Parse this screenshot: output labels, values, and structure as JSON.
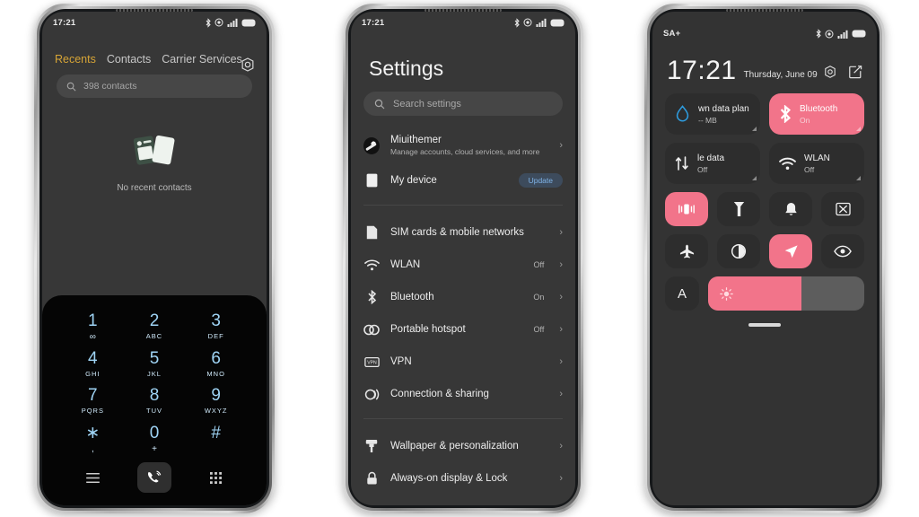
{
  "phone1": {
    "status": {
      "time": "17:21",
      "icons": [
        "bluetooth-icon",
        "location-icon",
        "signal-icon",
        "battery-icon"
      ]
    },
    "settings_icon": "gear-icon",
    "tabs": [
      {
        "label": "Recents",
        "active": true
      },
      {
        "label": "Contacts",
        "active": false
      },
      {
        "label": "Carrier Services",
        "active": false
      }
    ],
    "search": {
      "placeholder": "398 contacts",
      "icon": "search-icon"
    },
    "empty_state": {
      "label": "No recent contacts",
      "icon": "contacts-cards-icon"
    },
    "keypad": {
      "keys": [
        {
          "digit": "1",
          "sub": "∞",
          "tiny": true
        },
        {
          "digit": "2",
          "sub": "ABC"
        },
        {
          "digit": "3",
          "sub": "DEF"
        },
        {
          "digit": "4",
          "sub": "GHI"
        },
        {
          "digit": "5",
          "sub": "JKL"
        },
        {
          "digit": "6",
          "sub": "MNO"
        },
        {
          "digit": "7",
          "sub": "PQRS"
        },
        {
          "digit": "8",
          "sub": "TUV"
        },
        {
          "digit": "9",
          "sub": "WXYZ"
        },
        {
          "digit": "∗",
          "sub": ","
        },
        {
          "digit": "0",
          "sub": "+"
        },
        {
          "digit": "#",
          "sub": ""
        }
      ],
      "bottom": {
        "left_icon": "menu-icon",
        "call_icon": "call-icon",
        "right_icon": "dialpad-icon"
      }
    },
    "accent": "#d6a436"
  },
  "phone2": {
    "status": {
      "time": "17:21",
      "icons": [
        "bluetooth-icon",
        "location-icon",
        "signal-icon",
        "battery-icon"
      ]
    },
    "title": "Settings",
    "search": {
      "placeholder": "Search settings",
      "icon": "search-icon"
    },
    "account": {
      "name": "Miuithemer",
      "subtitle": "Manage accounts, cloud services, and more",
      "icon": "account-avatar"
    },
    "device": {
      "label": "My device",
      "badge": "Update",
      "icon": "device-icon"
    },
    "items": [
      {
        "label": "SIM cards & mobile networks",
        "value": "",
        "icon": "sim-icon"
      },
      {
        "label": "WLAN",
        "value": "Off",
        "icon": "wifi-icon"
      },
      {
        "label": "Bluetooth",
        "value": "On",
        "icon": "bluetooth-icon"
      },
      {
        "label": "Portable hotspot",
        "value": "Off",
        "icon": "hotspot-icon"
      },
      {
        "label": "VPN",
        "value": "",
        "icon": "vpn-icon"
      },
      {
        "label": "Connection & sharing",
        "value": "",
        "icon": "connection-sharing-icon"
      }
    ],
    "items2": [
      {
        "label": "Wallpaper & personalization",
        "value": "",
        "icon": "brush-icon"
      },
      {
        "label": "Always-on display & Lock",
        "value": "",
        "icon": "lock-icon"
      }
    ],
    "chevron": "›",
    "update_color": "#7fb4e8"
  },
  "phone3": {
    "status": {
      "left": "SA+",
      "icons": [
        "bluetooth-icon",
        "location-icon",
        "signal-icon",
        "battery-icon"
      ]
    },
    "clock": {
      "time": "17:21",
      "date": "Thursday, June 09"
    },
    "header_actions": [
      {
        "icon": "gear-icon",
        "name": "settings-shortcut"
      },
      {
        "icon": "edit-icon",
        "name": "edit-tiles-shortcut"
      }
    ],
    "big_tiles": [
      {
        "title": "wn data plan",
        "sub": "-- MB",
        "icon": "data-drop-icon",
        "on": false
      },
      {
        "title": "Bluetooth",
        "sub": "On",
        "icon": "bluetooth-icon",
        "on": true
      }
    ],
    "big_tiles2": [
      {
        "title": "le data",
        "sub": "Off",
        "icon": "mobile-data-icon",
        "on": false
      },
      {
        "title": "WLAN",
        "sub": "Off",
        "icon": "wifi-icon",
        "on": false
      }
    ],
    "small_tiles_row1": [
      {
        "icon": "vibrate-icon",
        "on": true
      },
      {
        "icon": "flashlight-icon",
        "on": false
      },
      {
        "icon": "bell-icon",
        "on": false
      },
      {
        "icon": "screenshot-icon",
        "on": false
      }
    ],
    "small_tiles_row2": [
      {
        "icon": "airplane-icon",
        "on": false
      },
      {
        "icon": "dark-mode-icon",
        "on": false
      },
      {
        "icon": "location-arrow-icon",
        "on": true
      },
      {
        "icon": "eye-care-icon",
        "on": false
      }
    ],
    "auto_brightness": {
      "label": "A",
      "icon": "auto-brightness-icon"
    },
    "brightness": {
      "percent": 60,
      "icon": "brightness-sun-icon"
    },
    "accent": "#f2748a",
    "handle": "drag-handle"
  }
}
